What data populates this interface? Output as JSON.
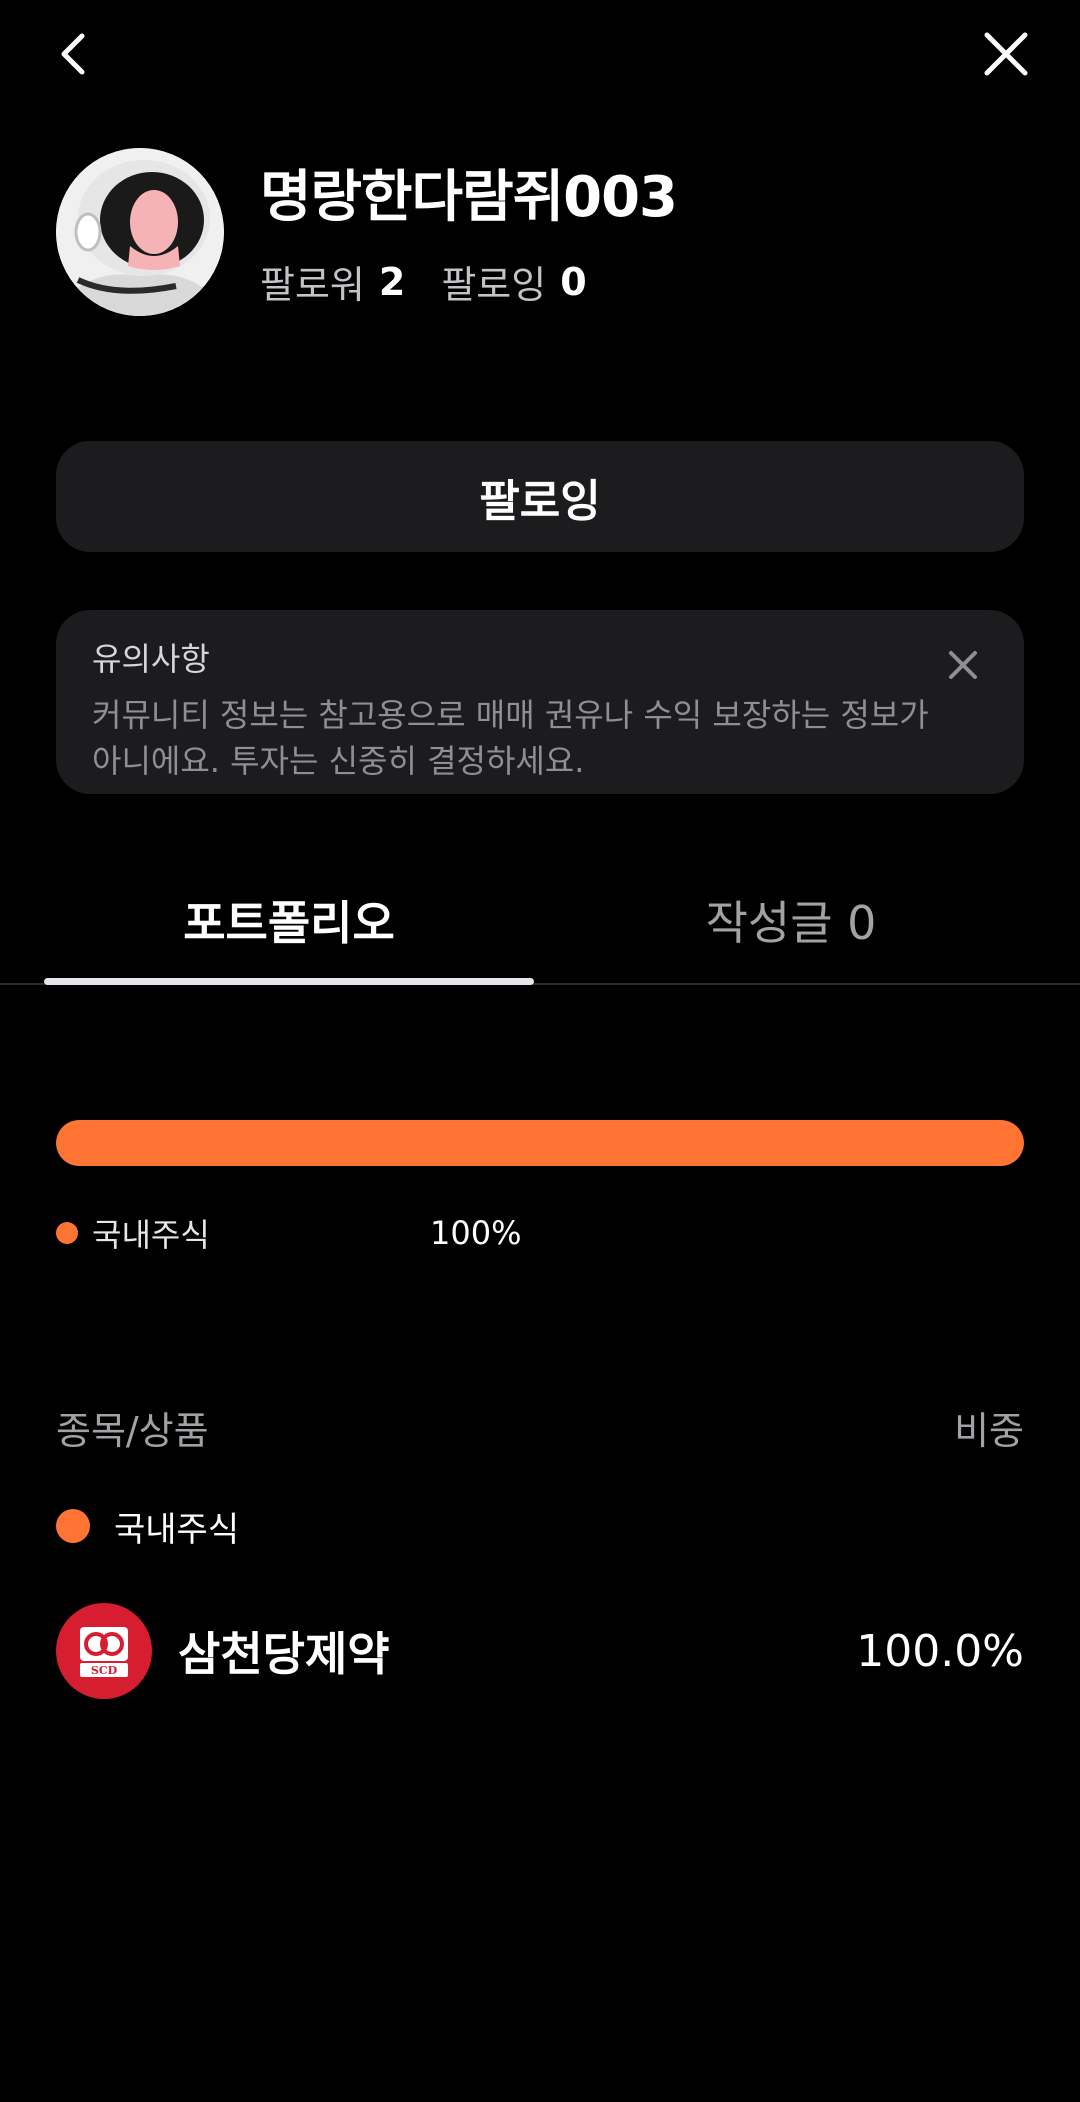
{
  "colors": {
    "background": "#000000",
    "accent_orange": "#ff7433",
    "card": "#1c1c1e",
    "logo_red": "#d71d30"
  },
  "nav": {
    "back_icon": "chevron-left-icon",
    "close_icon": "close-icon"
  },
  "profile": {
    "avatar_icon": "astronaut-avatar",
    "name": "명랑한다람쥐003",
    "followers_label": "팔로워",
    "followers_count": "2",
    "following_label": "팔로잉",
    "following_count": "0"
  },
  "follow_button": {
    "label": "팔로잉"
  },
  "notice": {
    "title": "유의사항",
    "body": "커뮤니티 정보는 참고용으로 매매 권유나 수익 보장하는 정보가 아니에요. 투자는 신중히 결정하세요.",
    "close_icon": "close-icon"
  },
  "tabs": [
    {
      "label": "포트폴리오",
      "active": true
    },
    {
      "label": "작성글 0",
      "active": false
    }
  ],
  "allocation": {
    "segments": [
      {
        "label": "국내주식",
        "percent_label": "100%",
        "fraction": 1.0,
        "color": "#ff7433"
      }
    ]
  },
  "holdings": {
    "header_left": "종목/상품",
    "header_right": "비중",
    "category": {
      "label": "국내주식",
      "color": "#ff7433"
    },
    "items": [
      {
        "name": "삼천당제약",
        "weight": "100.0%",
        "logo_text": "SCD",
        "logo_icon": "scd-logo"
      }
    ]
  }
}
